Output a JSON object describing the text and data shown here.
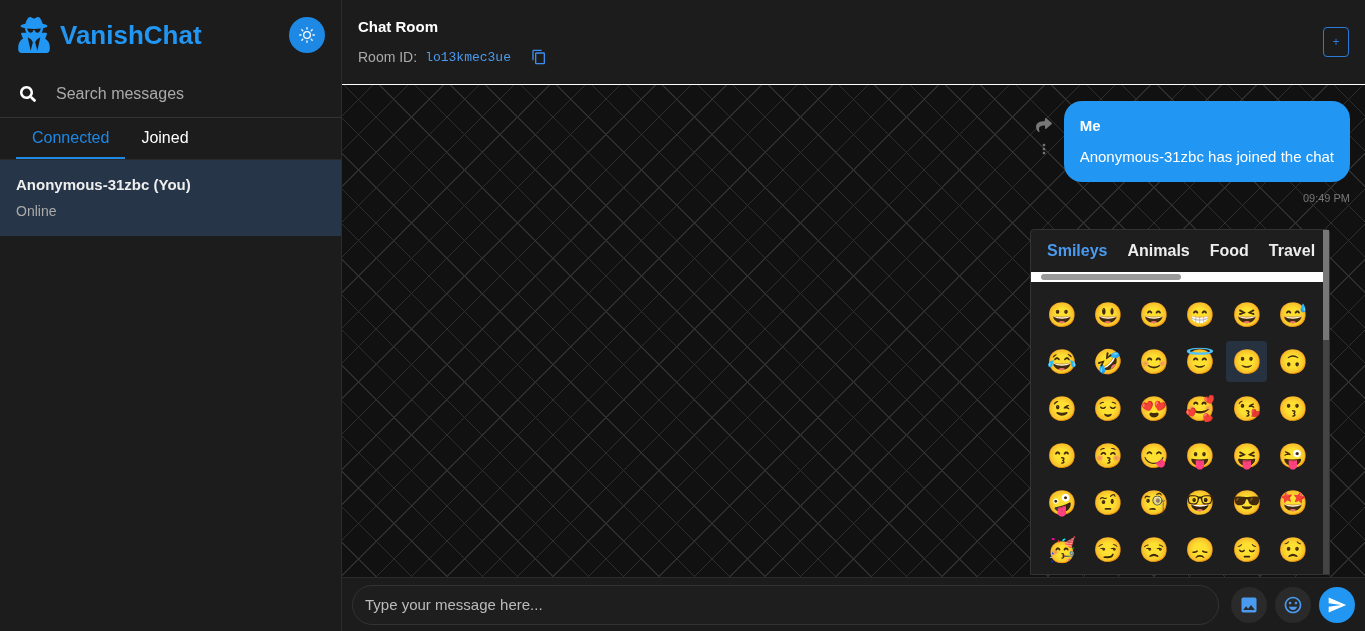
{
  "brand": {
    "name": "VanishChat"
  },
  "search": {
    "placeholder": "Search messages"
  },
  "tabs": [
    {
      "label": "Connected",
      "selected": true
    },
    {
      "label": "Joined",
      "selected": false
    }
  ],
  "users": [
    {
      "name": "Anonymous-31zbc (You)",
      "status": "Online",
      "selected": true
    }
  ],
  "room": {
    "title": "Chat Room",
    "id_label": "Room ID:",
    "id": "lo13kmec3ue",
    "add_button": "+"
  },
  "messages": [
    {
      "sender": "Me",
      "text": "Anonymous-31zbc has joined the chat",
      "time": "09:49 PM"
    }
  ],
  "emoji_picker": {
    "categories": [
      {
        "label": "Smileys",
        "selected": true
      },
      {
        "label": "Animals",
        "selected": false
      },
      {
        "label": "Food",
        "selected": false
      },
      {
        "label": "Travel",
        "selected": false
      }
    ],
    "emojis": [
      {
        "char": "😀",
        "selected": false
      },
      {
        "char": "😃",
        "selected": false
      },
      {
        "char": "😄",
        "selected": false
      },
      {
        "char": "😁",
        "selected": false
      },
      {
        "char": "😆",
        "selected": false
      },
      {
        "char": "😅",
        "selected": false
      },
      {
        "char": "😂",
        "selected": false
      },
      {
        "char": "🤣",
        "selected": false
      },
      {
        "char": "😊",
        "selected": false
      },
      {
        "char": "😇",
        "selected": false
      },
      {
        "char": "🙂",
        "selected": true
      },
      {
        "char": "🙃",
        "selected": false
      },
      {
        "char": "😉",
        "selected": false
      },
      {
        "char": "😌",
        "selected": false
      },
      {
        "char": "😍",
        "selected": false
      },
      {
        "char": "🥰",
        "selected": false
      },
      {
        "char": "😘",
        "selected": false
      },
      {
        "char": "😗",
        "selected": false
      },
      {
        "char": "😙",
        "selected": false
      },
      {
        "char": "😚",
        "selected": false
      },
      {
        "char": "😋",
        "selected": false
      },
      {
        "char": "😛",
        "selected": false
      },
      {
        "char": "😝",
        "selected": false
      },
      {
        "char": "😜",
        "selected": false
      },
      {
        "char": "🤪",
        "selected": false
      },
      {
        "char": "🤨",
        "selected": false
      },
      {
        "char": "🧐",
        "selected": false
      },
      {
        "char": "🤓",
        "selected": false
      },
      {
        "char": "😎",
        "selected": false
      },
      {
        "char": "🤩",
        "selected": false
      },
      {
        "char": "🥳",
        "selected": false
      },
      {
        "char": "😏",
        "selected": false
      },
      {
        "char": "😒",
        "selected": false
      },
      {
        "char": "😞",
        "selected": false
      },
      {
        "char": "😔",
        "selected": false
      },
      {
        "char": "😟",
        "selected": false
      }
    ]
  },
  "composer": {
    "placeholder": "Type your message here..."
  }
}
